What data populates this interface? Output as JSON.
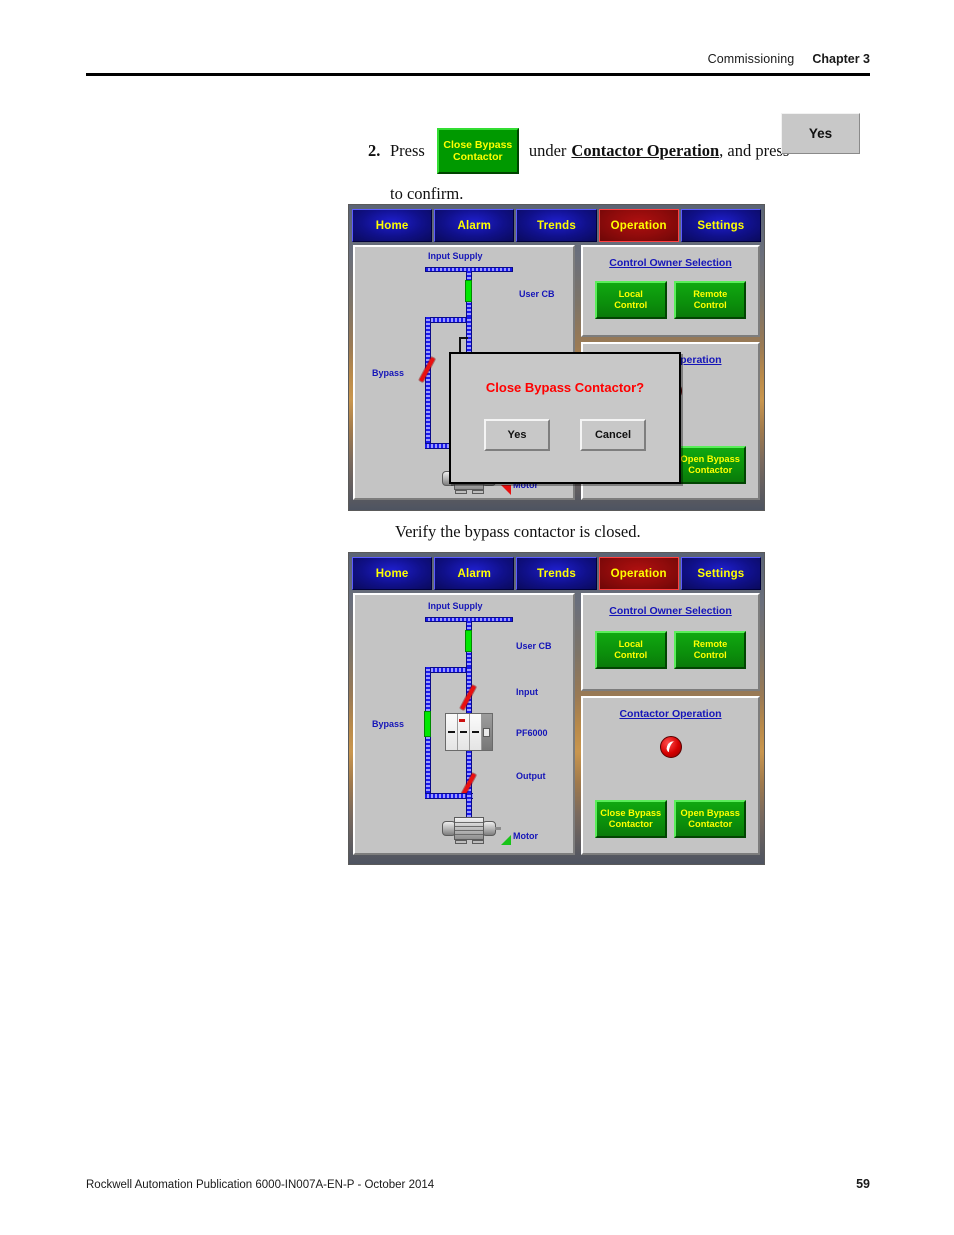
{
  "header": {
    "section": "Commissioning",
    "chapter": "Chapter 3"
  },
  "step": {
    "number": "2.",
    "press_word": "Press",
    "green_button_line1": "Close Bypass",
    "green_button_line2": "Contactor",
    "mid_text_1": "under",
    "emphasis": "Contactor Operation",
    "mid_text_2": ", and press",
    "yes_button": "Yes",
    "line2": "to confirm."
  },
  "caption": {
    "verify": "Verify the bypass contactor is closed."
  },
  "hmi": {
    "tabs": [
      {
        "label": "Home",
        "active": false
      },
      {
        "label": "Alarm",
        "active": false
      },
      {
        "label": "Trends",
        "active": false
      },
      {
        "label": "Operation",
        "active": true
      },
      {
        "label": "Settings",
        "active": false
      }
    ],
    "diagram_labels": {
      "input_supply": "Input Supply",
      "user_cb": "User CB",
      "input": "Input",
      "pf6000": "PF6000",
      "output": "Output",
      "bypass": "Bypass",
      "motor": "Motor"
    },
    "control_owner": {
      "title": "Control Owner Selection",
      "local_line1": "Local",
      "local_line2": "Control",
      "remote_line1": "Remote",
      "remote_line2": "Control"
    },
    "contactor_operation": {
      "title": "Contactor Operation",
      "close_line1": "Close Bypass",
      "close_line2": "Contactor",
      "open_line1": "Open Bypass",
      "open_line2": "Contactor"
    }
  },
  "dialog": {
    "title": "Close Bypass Contactor?",
    "yes": "Yes",
    "cancel": "Cancel"
  },
  "screen_states": {
    "screen1": {
      "bypass": "open",
      "motor_status_color": "#e81010"
    },
    "screen2": {
      "bypass": "closed",
      "motor_status_color": "#18c418"
    }
  },
  "colors": {
    "tab_active": "#8e0b0b",
    "tab_normal": "#10108a",
    "tab_text": "#ffff00",
    "green_button": "#0b8f0b",
    "panel_bg": "#c4c4c4",
    "label_blue": "#1515b8",
    "alert_red": "#ff0000",
    "closed_green": "#00e800",
    "open_red": "#e81010"
  },
  "footer": {
    "publication": "Rockwell Automation Publication 6000-IN007A-EN-P - October 2014",
    "page": "59"
  }
}
